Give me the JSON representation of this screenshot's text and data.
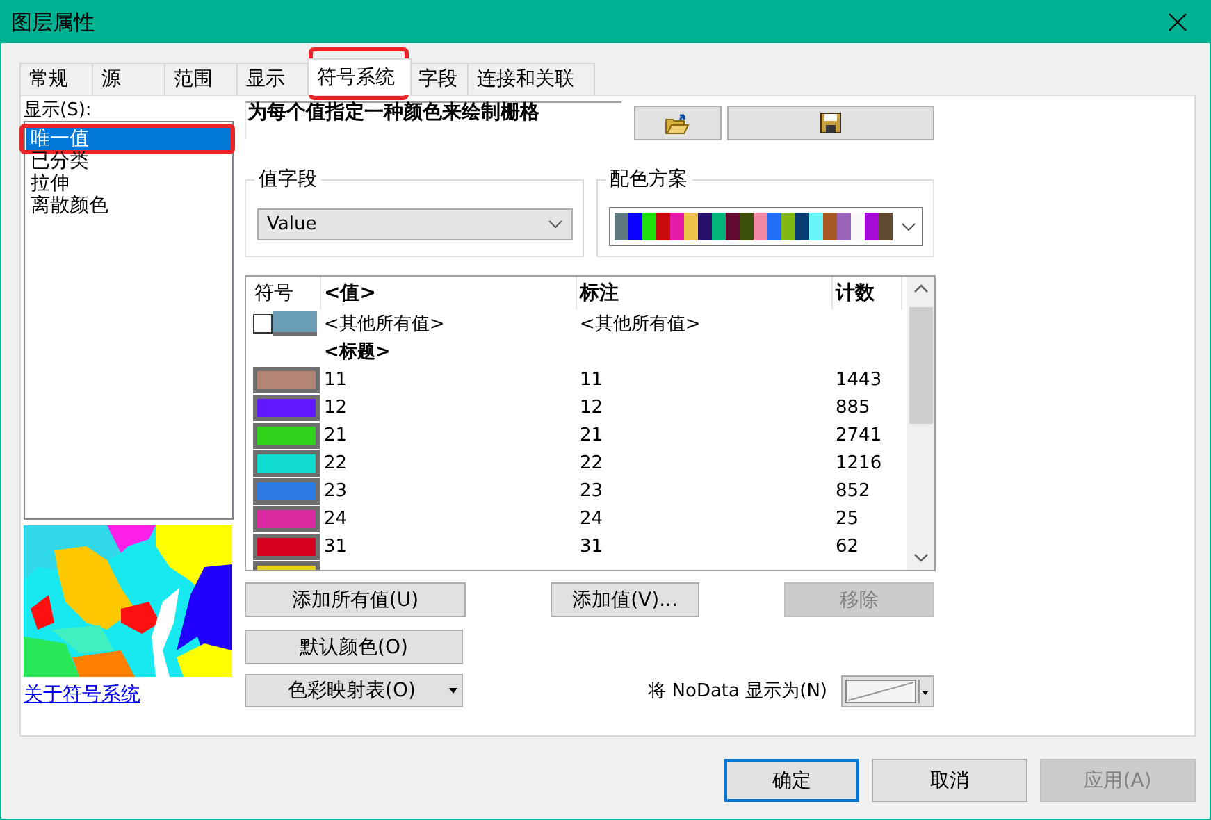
{
  "window": {
    "title": "图层属性"
  },
  "tabs": [
    {
      "label": "常规",
      "selected": false,
      "highlighted": false
    },
    {
      "label": "源",
      "selected": false,
      "highlighted": false
    },
    {
      "label": "范围",
      "selected": false,
      "highlighted": false
    },
    {
      "label": "显示",
      "selected": false,
      "highlighted": false
    },
    {
      "label": "符号系统",
      "selected": true,
      "highlighted": true
    },
    {
      "label": "字段",
      "selected": false,
      "highlighted": false
    },
    {
      "label": "连接和关联",
      "selected": false,
      "highlighted": false
    }
  ],
  "show_list": {
    "label": "显示(S):",
    "items": [
      {
        "label": "唯一值",
        "selected": true,
        "highlighted": true
      },
      {
        "label": "已分类",
        "selected": false,
        "highlighted": false
      },
      {
        "label": "拉伸",
        "selected": false,
        "highlighted": false
      },
      {
        "label": "离散颜色",
        "selected": false,
        "highlighted": false
      }
    ]
  },
  "about_link": "关于符号系统",
  "description": "为每个值指定一种颜色来绘制栅格",
  "value_field": {
    "label": "值字段",
    "value": "Value"
  },
  "color_scheme": {
    "label": "配色方案",
    "colors": [
      {
        "color": "#607880"
      },
      {
        "color": "#0a00ff"
      },
      {
        "color": "#1ee00a"
      },
      {
        "color": "#c80a0a"
      },
      {
        "color": "#e61aa8"
      },
      {
        "color": "#ecc24a"
      },
      {
        "color": "#28106a"
      },
      {
        "color": "#00b47a"
      },
      {
        "color": "#600a30"
      },
      {
        "color": "#3c500a"
      },
      {
        "color": "#f08aa2"
      },
      {
        "color": "#1f6ef5"
      },
      {
        "color": "#82b812"
      },
      {
        "color": "#083c72"
      },
      {
        "color": "#6af6f8"
      },
      {
        "color": "#a55a24"
      },
      {
        "color": "#9b64b8"
      },
      {
        "color": "#f8f8f8"
      },
      {
        "color": "#a60ad8"
      },
      {
        "color": "#604a32"
      }
    ]
  },
  "table": {
    "columns": [
      {
        "label": "符号",
        "bold": false
      },
      {
        "label": "<值>",
        "bold": true
      },
      {
        "label": "标注",
        "bold": true
      },
      {
        "label": "计数",
        "bold": true
      }
    ],
    "rows": [
      {
        "kind": "other",
        "checked": false,
        "color": "#6a9fb5",
        "value": "<其他所有值>",
        "label": "<其他所有值>"
      },
      {
        "kind": "heading",
        "value": "<标题>"
      },
      {
        "kind": "value",
        "color": "#b48474",
        "value": "11",
        "label": "11",
        "count": "1443"
      },
      {
        "kind": "value",
        "color": "#6218ff",
        "value": "12",
        "label": "12",
        "count": "885"
      },
      {
        "kind": "value",
        "color": "#30d21c",
        "value": "21",
        "label": "21",
        "count": "2741"
      },
      {
        "kind": "value",
        "color": "#10dcd0",
        "value": "22",
        "label": "22",
        "count": "1216"
      },
      {
        "kind": "value",
        "color": "#2a7ae2",
        "value": "23",
        "label": "23",
        "count": "852"
      },
      {
        "kind": "value",
        "color": "#da28a0",
        "value": "24",
        "label": "24",
        "count": "25"
      },
      {
        "kind": "value",
        "color": "#d80020",
        "value": "31",
        "label": "31",
        "count": "62"
      },
      {
        "kind": "value",
        "color": "#e8d020"
      }
    ]
  },
  "buttons": {
    "add_all": "添加所有值(U)",
    "add_value": "添加值(V)...",
    "remove": {
      "label": "移除",
      "disabled": true
    },
    "default_colors": "默认颜色(O)",
    "colormap": "色彩映射表(O)"
  },
  "nodata": {
    "label": "将 NoData 显示为(N)"
  },
  "footer": [
    {
      "label": "确定",
      "disabled": false,
      "focused": true
    },
    {
      "label": "取消",
      "disabled": false,
      "focused": false
    },
    {
      "label": "应用(A)",
      "disabled": true,
      "focused": false
    }
  ]
}
